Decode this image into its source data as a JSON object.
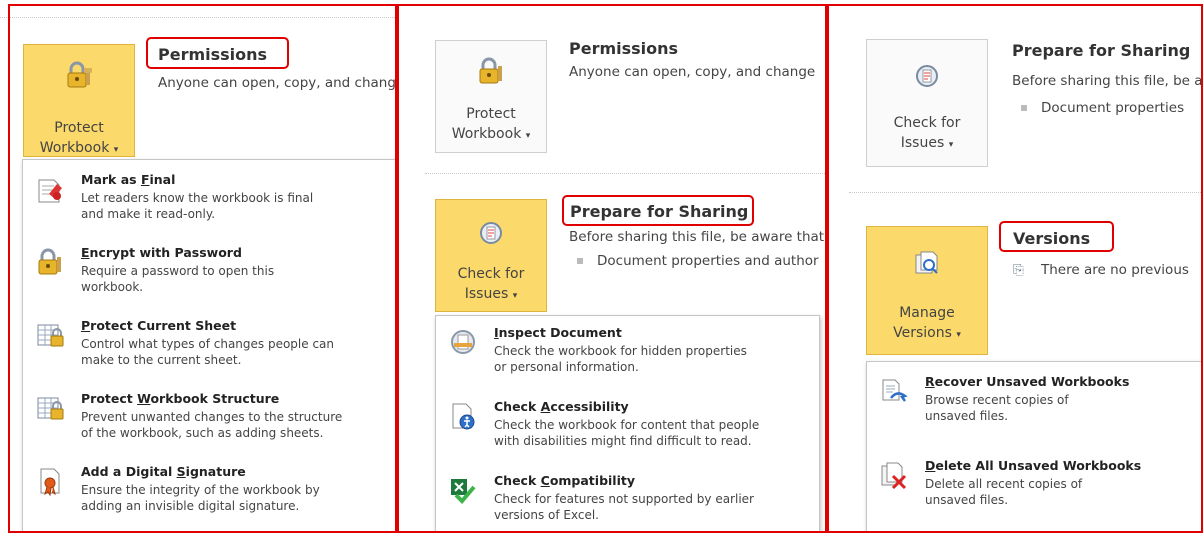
{
  "panel1": {
    "button": {
      "line1": "Protect",
      "line2": "Workbook"
    },
    "title": "Permissions",
    "desc": "Anyone can open, copy, and change",
    "menu": [
      {
        "pre": "Mark as ",
        "key": "F",
        "post": "inal",
        "desc1": "Let readers know the workbook is final",
        "desc2": "and make it read-only."
      },
      {
        "pre": "",
        "key": "E",
        "post": "ncrypt with Password",
        "desc1": "Require a password to open this",
        "desc2": "workbook."
      },
      {
        "pre": "",
        "key": "P",
        "post": "rotect Current Sheet",
        "desc1": "Control what types of changes people can",
        "desc2": "make to the current sheet."
      },
      {
        "pre": "Protect ",
        "key": "W",
        "post": "orkbook Structure",
        "desc1": "Prevent unwanted changes to the structure",
        "desc2": "of the workbook, such as adding sheets."
      },
      {
        "pre": "Add a Digital ",
        "key": "S",
        "post": "ignature",
        "desc1": "Ensure the integrity of the workbook by",
        "desc2": "adding an invisible digital signature."
      }
    ]
  },
  "panel2": {
    "top": {
      "button": {
        "line1": "Protect",
        "line2": "Workbook"
      },
      "title": "Permissions",
      "desc": "Anyone can open, copy, and change"
    },
    "button": {
      "line1": "Check for",
      "line2": "Issues"
    },
    "title": "Prepare for Sharing",
    "desc": "Before sharing this file, be aware that",
    "bullet": "Document properties and author",
    "menu": [
      {
        "pre": "",
        "key": "I",
        "post": "nspect Document",
        "desc1": "Check the workbook for hidden properties",
        "desc2": "or personal information."
      },
      {
        "pre": "Check ",
        "key": "A",
        "post": "ccessibility",
        "desc1": "Check the workbook for content that people",
        "desc2": "with disabilities might find difficult to read."
      },
      {
        "pre": "Check ",
        "key": "C",
        "post": "ompatibility",
        "desc1": "Check for features not supported by earlier",
        "desc2": "versions of Excel."
      }
    ]
  },
  "panel3": {
    "top": {
      "button": {
        "line1": "Check for",
        "line2": "Issues"
      },
      "title": "Prepare for Sharing",
      "desc": "Before sharing this file, be aware",
      "bullet": "Document properties"
    },
    "button": {
      "line1": "Manage",
      "line2": "Versions"
    },
    "title": "Versions",
    "desc": "There are no previous",
    "menu": [
      {
        "pre": "",
        "key": "R",
        "post": "ecover Unsaved Workbooks",
        "desc1": "Browse recent copies of",
        "desc2": "unsaved files."
      },
      {
        "pre": "",
        "key": "D",
        "post": "elete All Unsaved Workbooks",
        "desc1": "Delete all recent copies of",
        "desc2": "unsaved files."
      }
    ]
  },
  "colors": {
    "frame": "#e00000",
    "active_button": "#fbd96a"
  }
}
